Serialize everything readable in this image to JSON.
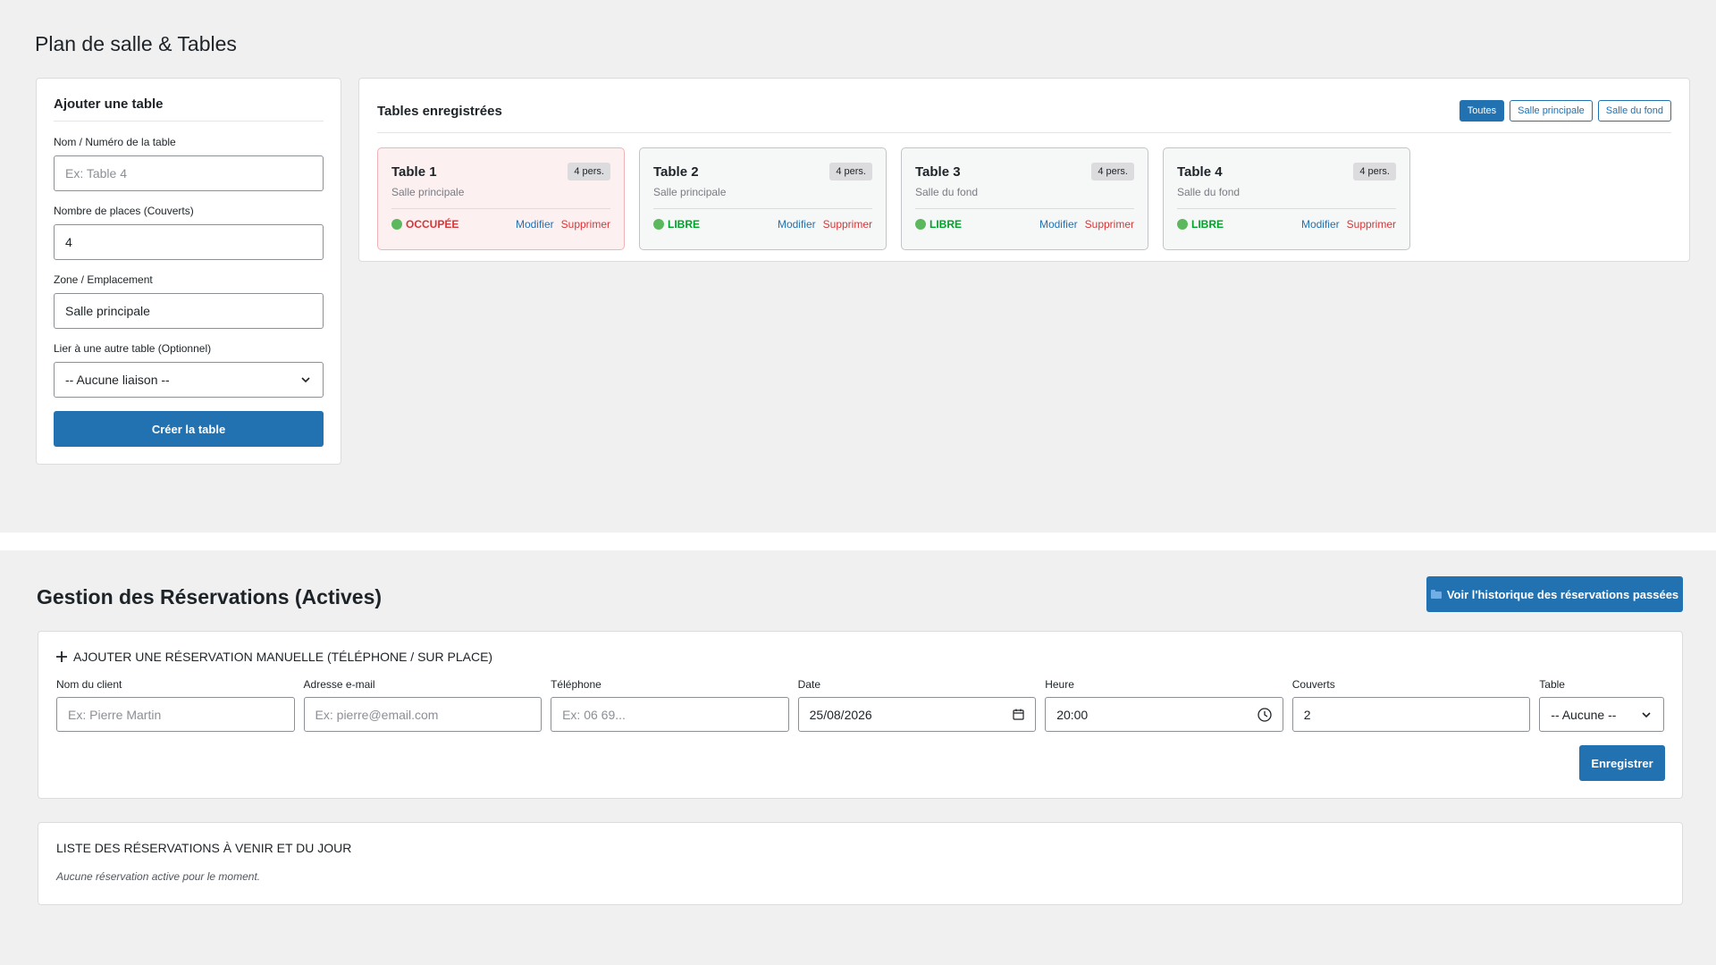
{
  "page": {
    "title": "Plan de salle & Tables"
  },
  "add_table": {
    "heading": "Ajouter une table",
    "name_label": "Nom / Numéro de la table",
    "name_placeholder": "Ex: Table 4",
    "seats_label": "Nombre de places (Couverts)",
    "seats_value": "4",
    "zone_label": "Zone / Emplacement",
    "zone_value": "Salle principale",
    "link_label": "Lier à une autre table (Optionnel)",
    "link_value": "-- Aucune liaison --",
    "submit_label": "Créer la table"
  },
  "tables_panel": {
    "title": "Tables enregistrées",
    "filters": [
      "Toutes",
      "Salle principale",
      "Salle du fond"
    ],
    "active_filter": "Toutes",
    "tables": [
      {
        "name": "Table 1",
        "capacity": "4 pers.",
        "zone": "Salle principale",
        "status": "OCCUPÉE",
        "occupied": true,
        "edit": "Modifier",
        "delete": "Supprimer"
      },
      {
        "name": "Table 2",
        "capacity": "4 pers.",
        "zone": "Salle principale",
        "status": "LIBRE",
        "occupied": false,
        "edit": "Modifier",
        "delete": "Supprimer"
      },
      {
        "name": "Table 3",
        "capacity": "4 pers.",
        "zone": "Salle du fond",
        "status": "LIBRE",
        "occupied": false,
        "edit": "Modifier",
        "delete": "Supprimer"
      },
      {
        "name": "Table 4",
        "capacity": "4 pers.",
        "zone": "Salle du fond",
        "status": "LIBRE",
        "occupied": false,
        "edit": "Modifier",
        "delete": "Supprimer"
      }
    ]
  },
  "reservations": {
    "title": "Gestion des Réservations (Actives)",
    "history_button": "Voir l'historique des réservations passées",
    "add_heading": "AJOUTER UNE RÉSERVATION MANUELLE (TÉLÉPHONE / SUR PLACE)",
    "fields": {
      "client_label": "Nom du client",
      "client_placeholder": "Ex: Pierre Martin",
      "email_label": "Adresse e-mail",
      "email_placeholder": "Ex: pierre@email.com",
      "phone_label": "Téléphone",
      "phone_placeholder": "Ex: 06 69...",
      "date_label": "Date",
      "date_value": "25/08/2026",
      "time_label": "Heure",
      "time_value": "20:00",
      "covers_label": "Couverts",
      "covers_value": "2",
      "table_label": "Table",
      "table_value": "-- Aucune --"
    },
    "save_label": "Enregistrer",
    "list_title": "LISTE DES RÉSERVATIONS À VENIR ET DU JOUR",
    "list_empty": "Aucune réservation active pour le moment."
  },
  "colors": {
    "primary": "#2271b1",
    "occupied": "#d63638",
    "free": "#00a32a",
    "free_dot": "#5cb85c"
  }
}
